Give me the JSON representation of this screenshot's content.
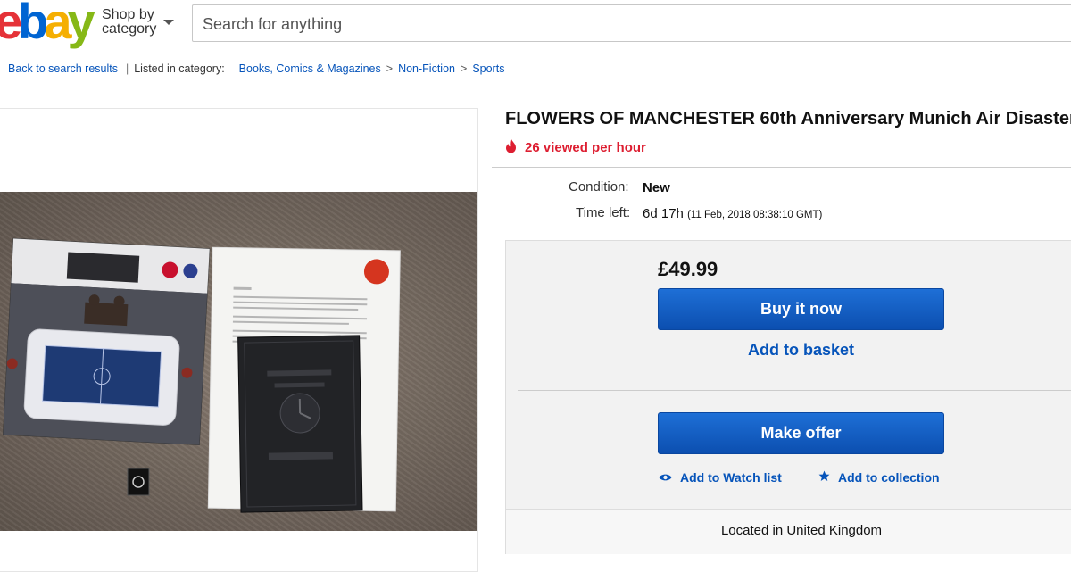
{
  "header": {
    "logo_letters": [
      "e",
      "b",
      "a",
      "y"
    ],
    "logo_colors": [
      "#e53238",
      "#0064d2",
      "#f5af02",
      "#86b817"
    ],
    "shop_by_line1": "Shop by",
    "shop_by_line2": "category",
    "search_placeholder": "Search for anything"
  },
  "breadcrumb": {
    "back": "Back to search results",
    "listed": "Listed in category:",
    "categories": [
      "Books, Comics & Magazines",
      "Non-Fiction",
      "Sports"
    ]
  },
  "item": {
    "title": "FLOWERS OF MANCHESTER 60th Anniversary Munich Air Disaster",
    "views": "26 viewed per hour",
    "condition_label": "Condition:",
    "condition_value": "New",
    "time_label": "Time left:",
    "time_value": "6d 17h",
    "time_date": "(11 Feb, 2018   08:38:10 GMT)"
  },
  "buy": {
    "price": "£49.99",
    "buy_now": "Buy it now",
    "add_basket": "Add to basket",
    "make_offer": "Make offer",
    "watch": "Add to Watch list",
    "collection": "Add to collection",
    "location": "Located in United Kingdom"
  },
  "colors": {
    "link": "#0654ba",
    "button": "#0c59c4",
    "alert": "#dd1e31"
  },
  "icons": {
    "flame": "flame-icon",
    "eye": "eye-icon",
    "star": "star-icon",
    "caret": "caret-down-icon"
  }
}
